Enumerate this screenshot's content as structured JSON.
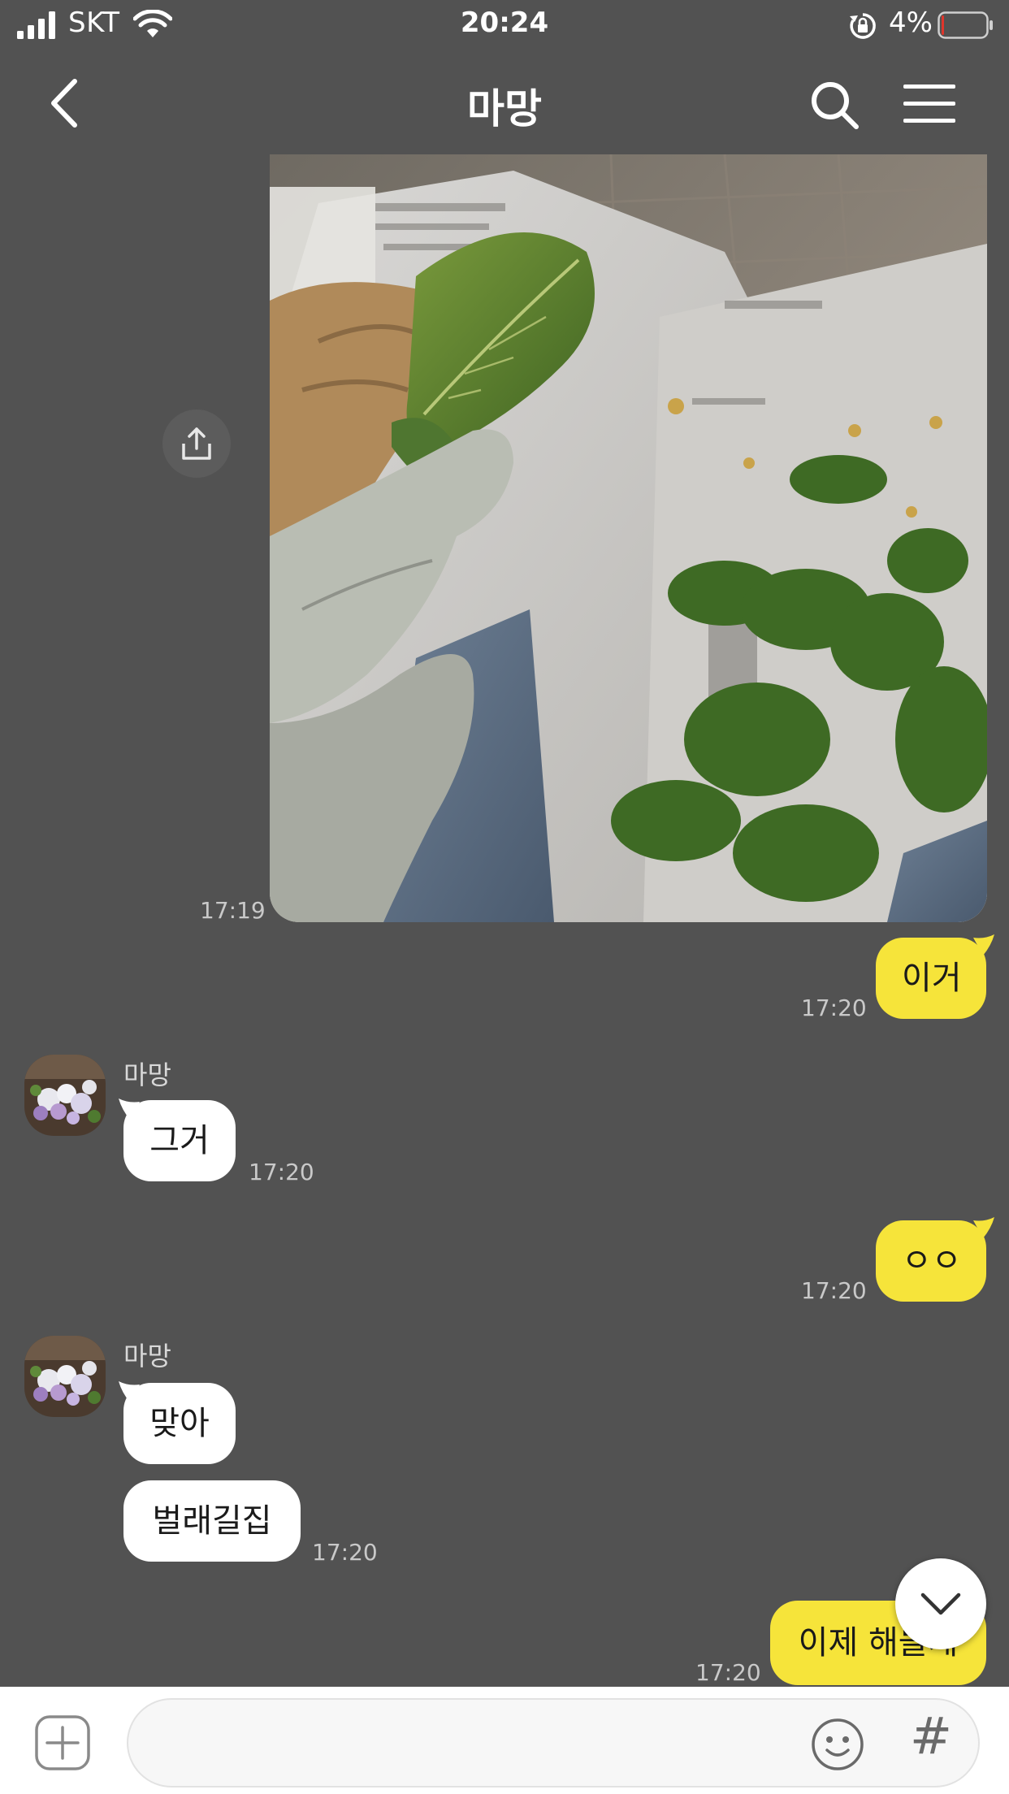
{
  "status": {
    "carrier": "SKT",
    "time": "20:24",
    "battery_percent": "4%",
    "battery_level": 0.04
  },
  "header": {
    "title": "마망",
    "back_icon": "chevron-left-icon",
    "search_icon": "search-icon",
    "menu_icon": "menu-icon"
  },
  "messages": [
    {
      "from": "me",
      "type": "photo",
      "time": "17:19"
    },
    {
      "from": "me",
      "type": "text",
      "text": "이거",
      "time": "17:20"
    },
    {
      "from": "other",
      "sender": "마망",
      "type": "text",
      "text": "그거",
      "time": "17:20"
    },
    {
      "from": "me",
      "type": "text",
      "text": "ㅇㅇ",
      "time": "17:20"
    },
    {
      "from": "other",
      "sender": "마망",
      "type": "text",
      "text": "맞아",
      "time": ""
    },
    {
      "from": "other",
      "sender": "",
      "type": "text",
      "text": "벌래길집",
      "time": "17:20"
    },
    {
      "from": "me",
      "type": "text",
      "text": "이제 해놀게",
      "time": "17:20"
    }
  ],
  "input": {
    "placeholder": "",
    "plus_icon": "plus-icon",
    "emoji_icon": "emoji-icon",
    "hash_label": "#"
  },
  "colors": {
    "background": "#525252",
    "my_bubble": "#f6e43a",
    "other_bubble": "#ffffff",
    "battery_low": "#e0352b"
  }
}
